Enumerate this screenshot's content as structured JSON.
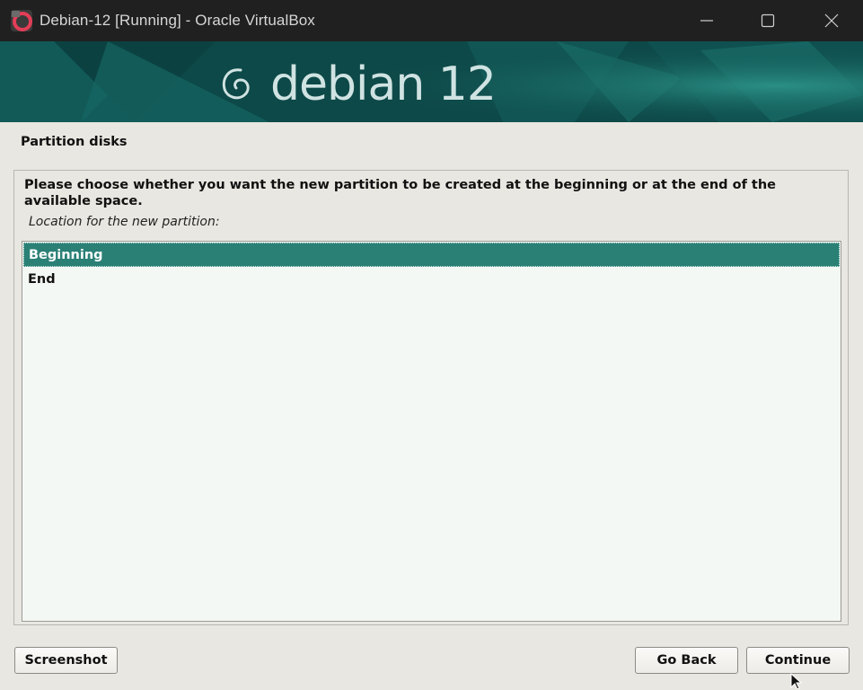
{
  "window": {
    "title": "Debian-12 [Running] - Oracle VirtualBox",
    "minimize_icon": "minimize-icon",
    "maximize_icon": "maximize-icon",
    "close_icon": "close-icon"
  },
  "banner": {
    "logo_icon": "debian-swirl-icon",
    "text": "debian 12"
  },
  "installer": {
    "section_title": "Partition disks",
    "question": "Please choose whether you want the new partition to be created at the beginning or at the end of the available space.",
    "field_label": "Location for the new partition:",
    "options": [
      {
        "label": "Beginning",
        "selected": true
      },
      {
        "label": "End",
        "selected": false
      }
    ]
  },
  "buttons": {
    "screenshot": "Screenshot",
    "go_back": "Go Back",
    "continue": "Continue"
  },
  "colors": {
    "selection": "#2b8076",
    "banner": "#0f4f4e",
    "titlebar": "#202020"
  }
}
